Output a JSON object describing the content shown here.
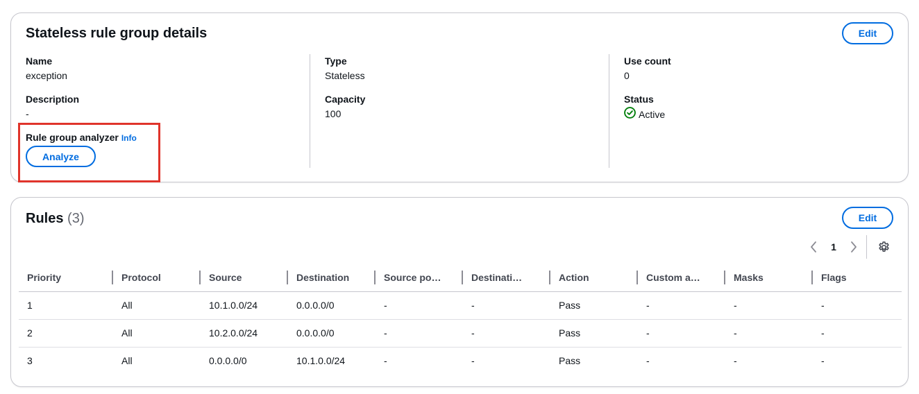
{
  "details": {
    "title": "Stateless rule group details",
    "edit_label": "Edit",
    "name_label": "Name",
    "name_value": "exception",
    "description_label": "Description",
    "description_value": "-",
    "analyzer_label": "Rule group analyzer",
    "info_label": "Info",
    "analyze_label": "Analyze",
    "type_label": "Type",
    "type_value": "Stateless",
    "capacity_label": "Capacity",
    "capacity_value": "100",
    "use_count_label": "Use count",
    "use_count_value": "0",
    "status_label": "Status",
    "status_value": "Active",
    "status_color": "#037f0c"
  },
  "rules": {
    "title": "Rules",
    "count": "(3)",
    "edit_label": "Edit",
    "current_page": "1",
    "columns": [
      "Priority",
      "Protocol",
      "Source",
      "Destination",
      "Source po…",
      "Destinati…",
      "Action",
      "Custom a…",
      "Masks",
      "Flags"
    ],
    "rows": [
      [
        "1",
        "All",
        "10.1.0.0/24",
        "0.0.0.0/0",
        "-",
        "-",
        "Pass",
        "-",
        "-",
        "-"
      ],
      [
        "2",
        "All",
        "10.2.0.0/24",
        "0.0.0.0/0",
        "-",
        "-",
        "Pass",
        "-",
        "-",
        "-"
      ],
      [
        "3",
        "All",
        "0.0.0.0/0",
        "10.1.0.0/24",
        "-",
        "-",
        "Pass",
        "-",
        "-",
        "-"
      ]
    ]
  },
  "colors": {
    "accent": "#006ce0",
    "highlight": "#e0342b",
    "border": "#c6c6cd"
  }
}
